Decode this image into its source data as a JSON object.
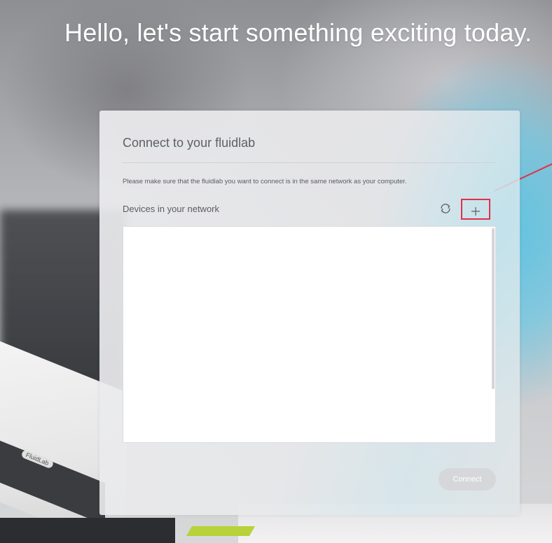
{
  "page": {
    "headline": "Hello, let's start something exciting today."
  },
  "card": {
    "title": "Connect to your fluidlab",
    "hint": "Please make sure that the fluidlab you want to connect is in the same network as your computer.",
    "devices_label": "Devices in your network",
    "refresh_icon": "refresh-icon",
    "add_icon": "plus-icon",
    "devices": [],
    "connect_label": "Connect",
    "connect_enabled": false
  },
  "background": {
    "device_label": "FluidLab"
  },
  "colors": {
    "highlight": "#e0304a",
    "connect_disabled": "#d6d7da",
    "accent_blue": "#5cc4e2"
  }
}
